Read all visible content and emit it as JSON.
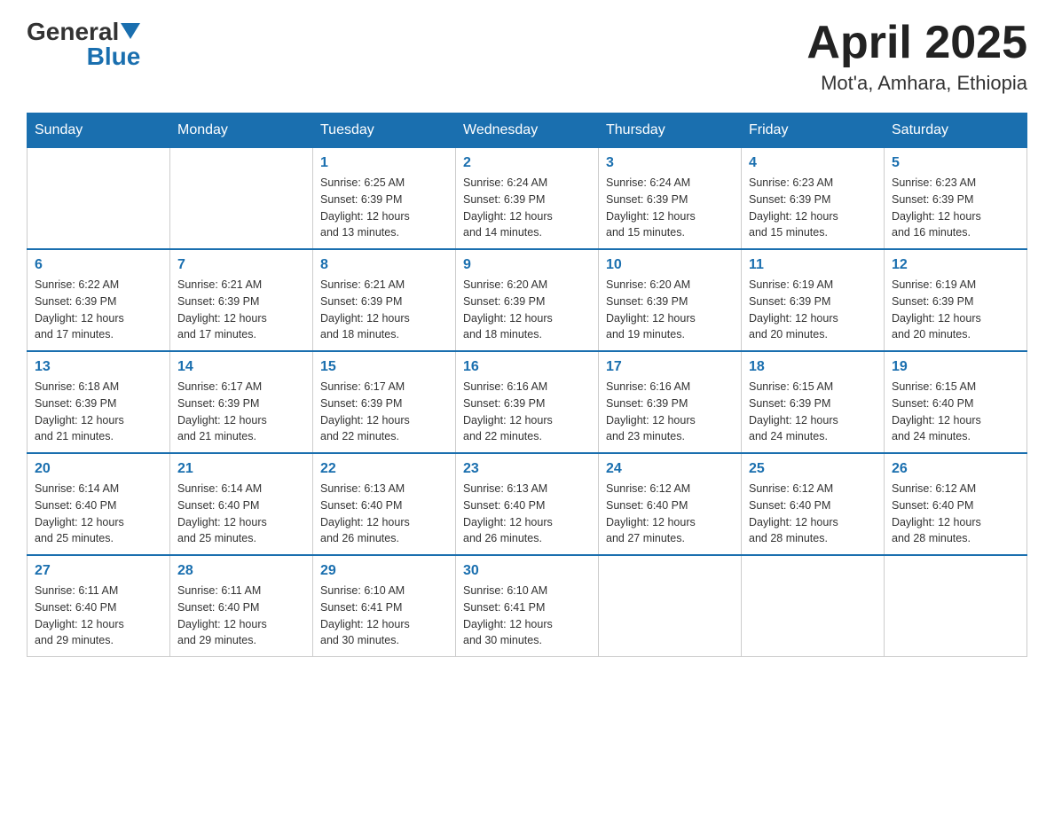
{
  "logo": {
    "text_general": "General",
    "text_blue": "Blue"
  },
  "header": {
    "title": "April 2025",
    "subtitle": "Mot'a, Amhara, Ethiopia"
  },
  "days_of_week": [
    "Sunday",
    "Monday",
    "Tuesday",
    "Wednesday",
    "Thursday",
    "Friday",
    "Saturday"
  ],
  "weeks": [
    [
      {
        "day": "",
        "info": ""
      },
      {
        "day": "",
        "info": ""
      },
      {
        "day": "1",
        "info": "Sunrise: 6:25 AM\nSunset: 6:39 PM\nDaylight: 12 hours\nand 13 minutes."
      },
      {
        "day": "2",
        "info": "Sunrise: 6:24 AM\nSunset: 6:39 PM\nDaylight: 12 hours\nand 14 minutes."
      },
      {
        "day": "3",
        "info": "Sunrise: 6:24 AM\nSunset: 6:39 PM\nDaylight: 12 hours\nand 15 minutes."
      },
      {
        "day": "4",
        "info": "Sunrise: 6:23 AM\nSunset: 6:39 PM\nDaylight: 12 hours\nand 15 minutes."
      },
      {
        "day": "5",
        "info": "Sunrise: 6:23 AM\nSunset: 6:39 PM\nDaylight: 12 hours\nand 16 minutes."
      }
    ],
    [
      {
        "day": "6",
        "info": "Sunrise: 6:22 AM\nSunset: 6:39 PM\nDaylight: 12 hours\nand 17 minutes."
      },
      {
        "day": "7",
        "info": "Sunrise: 6:21 AM\nSunset: 6:39 PM\nDaylight: 12 hours\nand 17 minutes."
      },
      {
        "day": "8",
        "info": "Sunrise: 6:21 AM\nSunset: 6:39 PM\nDaylight: 12 hours\nand 18 minutes."
      },
      {
        "day": "9",
        "info": "Sunrise: 6:20 AM\nSunset: 6:39 PM\nDaylight: 12 hours\nand 18 minutes."
      },
      {
        "day": "10",
        "info": "Sunrise: 6:20 AM\nSunset: 6:39 PM\nDaylight: 12 hours\nand 19 minutes."
      },
      {
        "day": "11",
        "info": "Sunrise: 6:19 AM\nSunset: 6:39 PM\nDaylight: 12 hours\nand 20 minutes."
      },
      {
        "day": "12",
        "info": "Sunrise: 6:19 AM\nSunset: 6:39 PM\nDaylight: 12 hours\nand 20 minutes."
      }
    ],
    [
      {
        "day": "13",
        "info": "Sunrise: 6:18 AM\nSunset: 6:39 PM\nDaylight: 12 hours\nand 21 minutes."
      },
      {
        "day": "14",
        "info": "Sunrise: 6:17 AM\nSunset: 6:39 PM\nDaylight: 12 hours\nand 21 minutes."
      },
      {
        "day": "15",
        "info": "Sunrise: 6:17 AM\nSunset: 6:39 PM\nDaylight: 12 hours\nand 22 minutes."
      },
      {
        "day": "16",
        "info": "Sunrise: 6:16 AM\nSunset: 6:39 PM\nDaylight: 12 hours\nand 22 minutes."
      },
      {
        "day": "17",
        "info": "Sunrise: 6:16 AM\nSunset: 6:39 PM\nDaylight: 12 hours\nand 23 minutes."
      },
      {
        "day": "18",
        "info": "Sunrise: 6:15 AM\nSunset: 6:39 PM\nDaylight: 12 hours\nand 24 minutes."
      },
      {
        "day": "19",
        "info": "Sunrise: 6:15 AM\nSunset: 6:40 PM\nDaylight: 12 hours\nand 24 minutes."
      }
    ],
    [
      {
        "day": "20",
        "info": "Sunrise: 6:14 AM\nSunset: 6:40 PM\nDaylight: 12 hours\nand 25 minutes."
      },
      {
        "day": "21",
        "info": "Sunrise: 6:14 AM\nSunset: 6:40 PM\nDaylight: 12 hours\nand 25 minutes."
      },
      {
        "day": "22",
        "info": "Sunrise: 6:13 AM\nSunset: 6:40 PM\nDaylight: 12 hours\nand 26 minutes."
      },
      {
        "day": "23",
        "info": "Sunrise: 6:13 AM\nSunset: 6:40 PM\nDaylight: 12 hours\nand 26 minutes."
      },
      {
        "day": "24",
        "info": "Sunrise: 6:12 AM\nSunset: 6:40 PM\nDaylight: 12 hours\nand 27 minutes."
      },
      {
        "day": "25",
        "info": "Sunrise: 6:12 AM\nSunset: 6:40 PM\nDaylight: 12 hours\nand 28 minutes."
      },
      {
        "day": "26",
        "info": "Sunrise: 6:12 AM\nSunset: 6:40 PM\nDaylight: 12 hours\nand 28 minutes."
      }
    ],
    [
      {
        "day": "27",
        "info": "Sunrise: 6:11 AM\nSunset: 6:40 PM\nDaylight: 12 hours\nand 29 minutes."
      },
      {
        "day": "28",
        "info": "Sunrise: 6:11 AM\nSunset: 6:40 PM\nDaylight: 12 hours\nand 29 minutes."
      },
      {
        "day": "29",
        "info": "Sunrise: 6:10 AM\nSunset: 6:41 PM\nDaylight: 12 hours\nand 30 minutes."
      },
      {
        "day": "30",
        "info": "Sunrise: 6:10 AM\nSunset: 6:41 PM\nDaylight: 12 hours\nand 30 minutes."
      },
      {
        "day": "",
        "info": ""
      },
      {
        "day": "",
        "info": ""
      },
      {
        "day": "",
        "info": ""
      }
    ]
  ]
}
